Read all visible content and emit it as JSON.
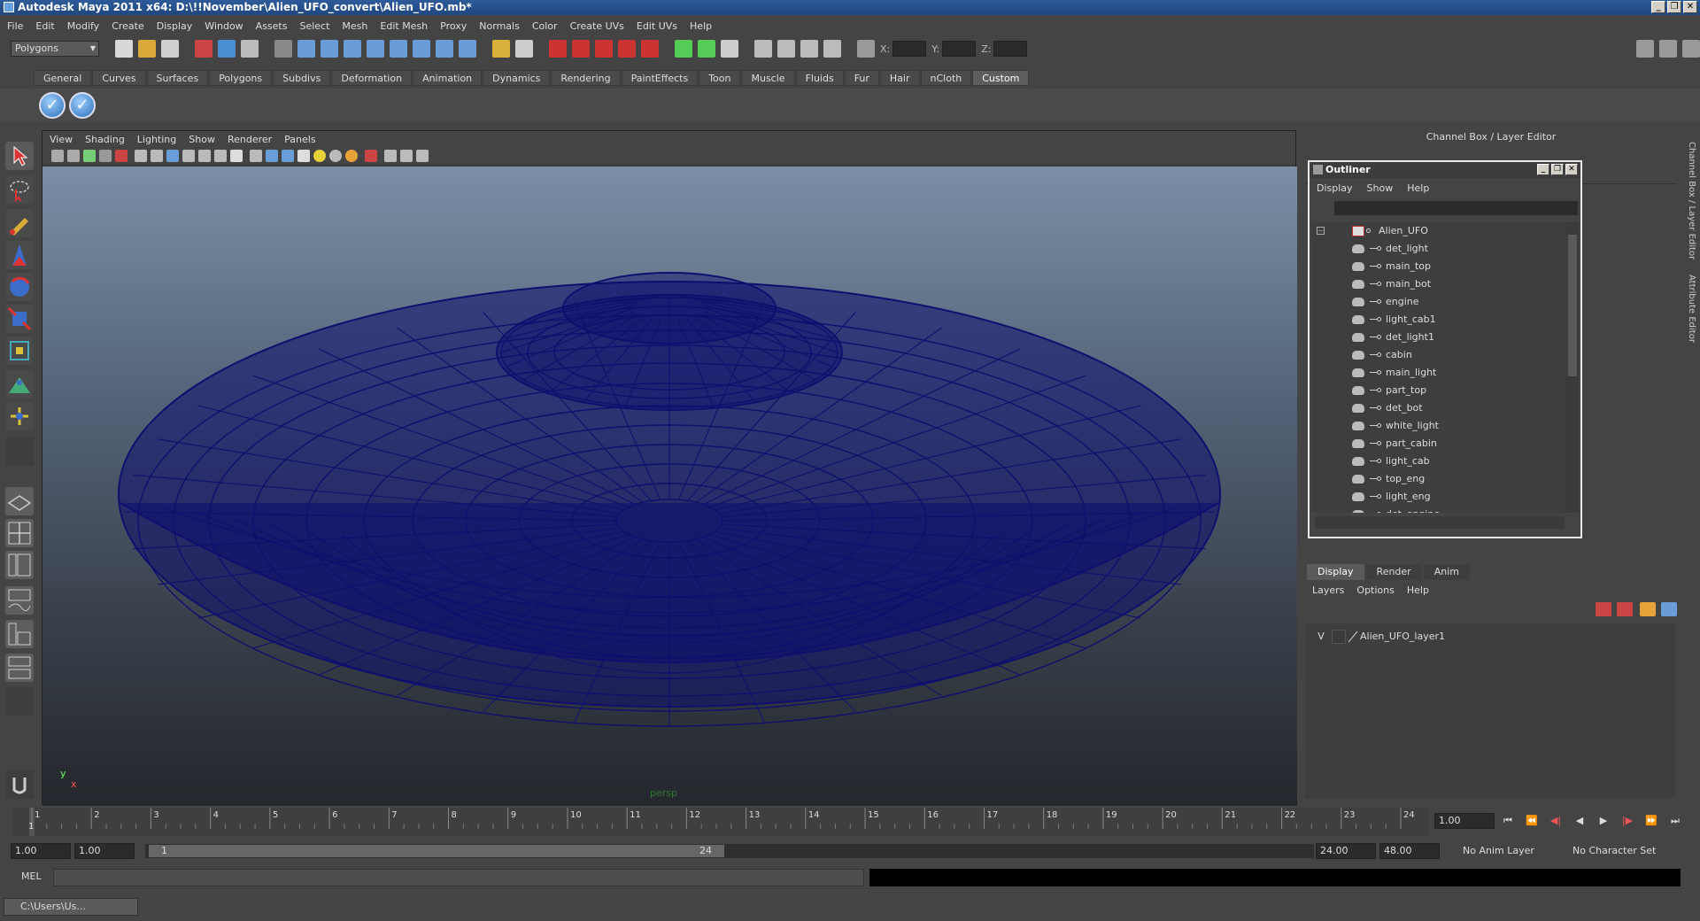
{
  "window": {
    "title": "Autodesk Maya 2011 x64: D:\\!!November\\Alien_UFO_convert\\Alien_UFO.mb*",
    "minimize": "_",
    "restore": "❐",
    "close": "✕"
  },
  "menubar": [
    "File",
    "Edit",
    "Modify",
    "Create",
    "Display",
    "Window",
    "Assets",
    "Select",
    "Mesh",
    "Edit Mesh",
    "Proxy",
    "Normals",
    "Color",
    "Create UVs",
    "Edit UVs",
    "Help"
  ],
  "statusline": {
    "mode": "Polygons",
    "coord_labels": [
      "X:",
      "Y:",
      "Z:"
    ]
  },
  "shelf": {
    "tabs": [
      "General",
      "Curves",
      "Surfaces",
      "Polygons",
      "Subdivs",
      "Deformation",
      "Animation",
      "Dynamics",
      "Rendering",
      "PaintEffects",
      "Toon",
      "Muscle",
      "Fluids",
      "Fur",
      "Hair",
      "nCloth",
      "Custom"
    ],
    "active_tab": "Custom"
  },
  "viewport": {
    "menus": [
      "View",
      "Shading",
      "Lighting",
      "Show",
      "Renderer",
      "Panels"
    ],
    "camera": "persp",
    "axis_y": "y",
    "axis_x": "x",
    "wire_color": "#0e0f6e"
  },
  "channel_box": {
    "title": "Channel Box / Layer Editor"
  },
  "outliner": {
    "title": "Outliner",
    "menus": [
      "Display",
      "Show",
      "Help"
    ],
    "root": "Alien_UFO",
    "collapse": "−",
    "items": [
      "det_light",
      "main_top",
      "main_bot",
      "engine",
      "light_cab1",
      "det_light1",
      "cabin",
      "main_light",
      "part_top",
      "det_bot",
      "white_light",
      "part_cabin",
      "light_cab",
      "top_eng",
      "light_eng",
      "det_engine"
    ]
  },
  "layer_editor": {
    "tabs": [
      "Display",
      "Render",
      "Anim"
    ],
    "active_tab": "Display",
    "menus": [
      "Layers",
      "Options",
      "Help"
    ],
    "layers": [
      {
        "visible": "V",
        "name": "Alien_UFO_layer1"
      }
    ]
  },
  "side_tabs": [
    "Channel Box / Layer Editor",
    "Attribute Editor"
  ],
  "timeline": {
    "ticks": [
      "1",
      "2",
      "3",
      "4",
      "5",
      "6",
      "7",
      "8",
      "9",
      "10",
      "11",
      "12",
      "13",
      "14",
      "15",
      "16",
      "17",
      "18",
      "19",
      "20",
      "21",
      "22",
      "23",
      "24"
    ],
    "current_frame_marker": "1",
    "current_time": "1.00"
  },
  "range": {
    "start_time": "1.00",
    "playback_start": "1.00",
    "slider_start": "1",
    "slider_end": "24",
    "playback_end": "24.00",
    "end_time": "48.00",
    "anim_layer": "No Anim Layer",
    "character_set": "No Character Set"
  },
  "playback_controls": [
    "⏮",
    "⏪",
    "◀|",
    "◀",
    "▶",
    "|▶",
    "⏩",
    "⏭"
  ],
  "command_line": {
    "label": "MEL"
  },
  "taskbar": {
    "item": "C:\\Users\\Us..."
  }
}
